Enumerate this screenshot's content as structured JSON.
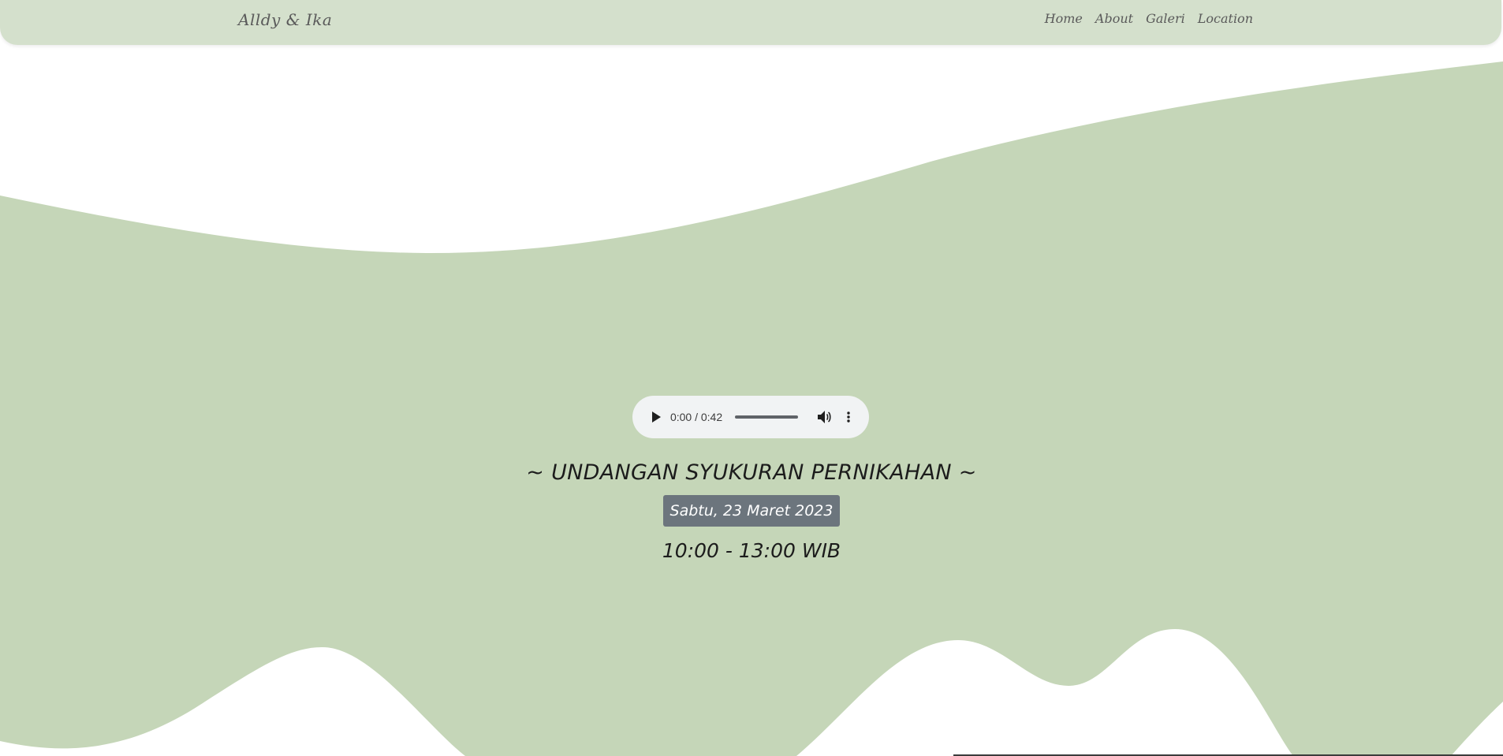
{
  "navbar": {
    "brand": "Alldy & Ika",
    "links": [
      "Home",
      "About",
      "Galeri",
      "Location"
    ]
  },
  "audio": {
    "time": "0:00 / 0:42",
    "play_icon": "play-icon",
    "volume_icon": "volume-icon",
    "more_icon": "more-vert-icon",
    "progress": 0
  },
  "hero": {
    "title": "~ UNDANGAN SYUKURAN PERNIKAHAN ~",
    "date": "Sabtu, 23 Maret 2023",
    "time": "10:00 - 13:00 WIB"
  },
  "colors": {
    "navbar_bg": "#d4e0cc",
    "wave_green": "#c5d6b8",
    "badge_bg": "#6c757d",
    "audio_bg": "#f1f3f4"
  }
}
